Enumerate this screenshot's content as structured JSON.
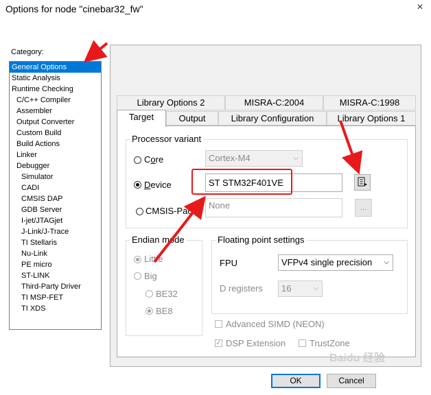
{
  "window": {
    "title": "Options for node \"cinebar32_fw\"",
    "close_label": "×"
  },
  "category": {
    "label": "Category:",
    "items": [
      {
        "label": "General Options",
        "indent": 0,
        "selected": true
      },
      {
        "label": "Static Analysis",
        "indent": 0
      },
      {
        "label": "Runtime Checking",
        "indent": 0
      },
      {
        "label": "C/C++ Compiler",
        "indent": 1
      },
      {
        "label": "Assembler",
        "indent": 1
      },
      {
        "label": "Output Converter",
        "indent": 1
      },
      {
        "label": "Custom Build",
        "indent": 1
      },
      {
        "label": "Build Actions",
        "indent": 1
      },
      {
        "label": "Linker",
        "indent": 1
      },
      {
        "label": "Debugger",
        "indent": 1
      },
      {
        "label": "Simulator",
        "indent": 2
      },
      {
        "label": "CADI",
        "indent": 2
      },
      {
        "label": "CMSIS DAP",
        "indent": 2
      },
      {
        "label": "GDB Server",
        "indent": 2
      },
      {
        "label": "I-jet/JTAGjet",
        "indent": 2
      },
      {
        "label": "J-Link/J-Trace",
        "indent": 2
      },
      {
        "label": "TI Stellaris",
        "indent": 2
      },
      {
        "label": "Nu-Link",
        "indent": 2
      },
      {
        "label": "PE micro",
        "indent": 2
      },
      {
        "label": "ST-LINK",
        "indent": 2
      },
      {
        "label": "Third-Party Driver",
        "indent": 2
      },
      {
        "label": "TI MSP-FET",
        "indent": 2
      },
      {
        "label": "TI XDS",
        "indent": 2
      }
    ]
  },
  "tabs": {
    "back_row": [
      "Library Options 2",
      "MISRA-C:2004",
      "MISRA-C:1998"
    ],
    "front_row": [
      "Target",
      "Output",
      "Library Configuration",
      "Library Options 1"
    ],
    "active": "Target"
  },
  "processor": {
    "legend": "Processor variant",
    "core_label_pre": "C",
    "core_label_u": "o",
    "core_label_post": "re",
    "core_value": "Cortex-M4",
    "device_label_pre": "",
    "device_label_u": "D",
    "device_label_post": "evice",
    "device_value": "ST STM32F401VE",
    "cmsis_label": "CMSIS-Pack",
    "cmsis_value": "None",
    "browse_label": "..."
  },
  "endian": {
    "legend": "Endian mode",
    "little": "Little",
    "big": "Big",
    "be32": "BE32",
    "be8": "BE8"
  },
  "fp": {
    "legend": "Floating point settings",
    "fpu_label": "FPU",
    "fpu_value": "VFPv4 single precision",
    "dreg_label": "D registers",
    "dreg_value": "16",
    "simd_label": "Advanced SIMD (NEON)",
    "dsp_label": "DSP Extension",
    "trustzone_label": "TrustZone"
  },
  "buttons": {
    "ok": "OK",
    "cancel": "Cancel"
  },
  "watermark": "Baidu 经验",
  "colors": {
    "selection": "#0078d7",
    "annotation_red": "#e8191c"
  }
}
